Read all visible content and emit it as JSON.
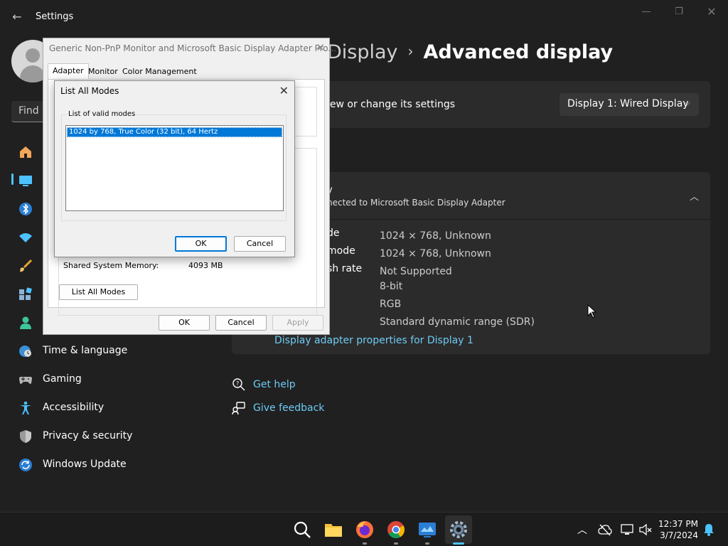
{
  "app": {
    "title": "Settings"
  },
  "sidebar": {
    "search_placeholder": "Find a",
    "items": [
      {
        "label": ""
      },
      {
        "label": ""
      },
      {
        "label": ""
      },
      {
        "label": ""
      },
      {
        "label": ""
      },
      {
        "label": ""
      },
      {
        "label": ""
      },
      {
        "label": "Time & language"
      },
      {
        "label": "Gaming"
      },
      {
        "label": "Accessibility"
      },
      {
        "label": "Privacy & security"
      },
      {
        "label": "Windows Update"
      }
    ]
  },
  "main": {
    "breadcrumb": {
      "parent": "Display",
      "separator": "›",
      "current": "Advanced display"
    },
    "select_display_desc": "iew or change its settings",
    "display_select": "Display 1: Wired Display",
    "info_card": {
      "title": "y",
      "subtitle": "nected to Microsoft Basic Display Adapter",
      "rows": [
        {
          "label": "de",
          "value": "1024 × 768, Unknown"
        },
        {
          "label": "mode",
          "value": "1024 × 768, Unknown"
        },
        {
          "label": "sh rate",
          "value": "Not Supported"
        },
        {
          "label": "",
          "value": "8-bit"
        },
        {
          "label": "",
          "value": "RGB"
        },
        {
          "label": "",
          "value": "Standard dynamic range (SDR)"
        }
      ],
      "link": "Display adapter properties for Display 1"
    },
    "help": {
      "get_help": "Get help",
      "give_feedback": "Give feedback"
    }
  },
  "properties_dialog": {
    "title": "Generic Non-PnP Monitor and Microsoft Basic Display Adapter Pro...",
    "tabs": [
      "Adapter",
      "Monitor",
      "Color Management"
    ],
    "shared_memory_label": "Shared System Memory:",
    "shared_memory_value": "4093 MB",
    "list_all_modes": "List All Modes",
    "ok": "OK",
    "cancel": "Cancel",
    "apply": "Apply"
  },
  "modes_dialog": {
    "title": "List All Modes",
    "group_label": "List of valid modes",
    "modes": [
      "1024 by 768, True Color (32 bit), 64 Hertz"
    ],
    "ok": "OK",
    "cancel": "Cancel"
  },
  "taskbar": {
    "time": "12:37 PM",
    "date": "3/7/2024"
  },
  "colors": {
    "accent": "#4cc2ff",
    "link": "#6ecbf5",
    "selection": "#0078d7"
  }
}
